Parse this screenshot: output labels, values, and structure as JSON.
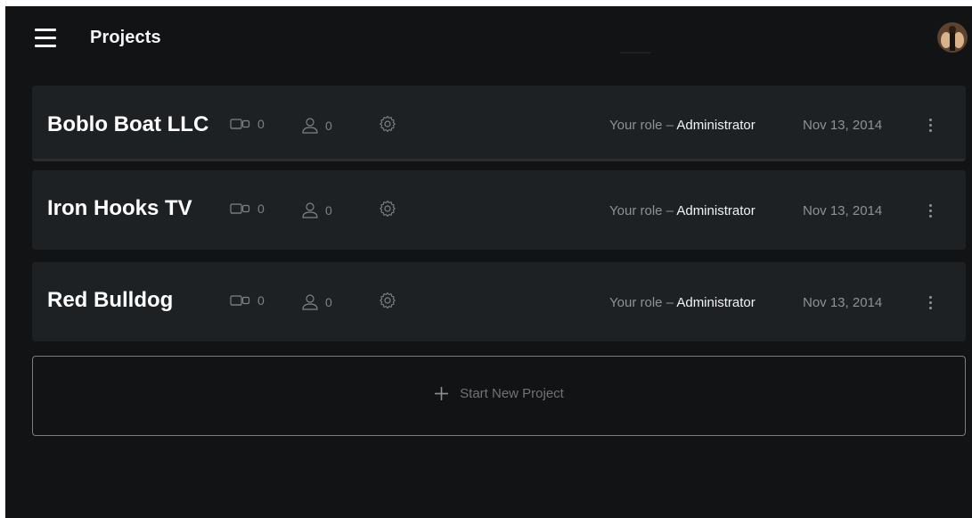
{
  "header": {
    "title": "Projects",
    "menu_icon": "hamburger-menu-icon",
    "avatar_icon": "user-avatar"
  },
  "projects": [
    {
      "name": "Boblo Boat LLC",
      "cameras": "0",
      "users": "0",
      "role_label": "Your role – ",
      "role": "Administrator",
      "date": "Nov 13, 2014"
    },
    {
      "name": "Iron Hooks TV",
      "cameras": "0",
      "users": "0",
      "role_label": "Your role – ",
      "role": "Administrator",
      "date": "Nov 13, 2014"
    },
    {
      "name": "Red Bulldog",
      "cameras": "0",
      "users": "0",
      "role_label": "Your role – ",
      "role": "Administrator",
      "date": "Nov 13, 2014"
    }
  ],
  "new_project": {
    "label": "Start New Project",
    "icon": "plus-icon"
  },
  "colors": {
    "background": "#121314",
    "row_background": "#1e2124",
    "text_primary": "#ffffff",
    "text_muted": "#8d9195"
  }
}
